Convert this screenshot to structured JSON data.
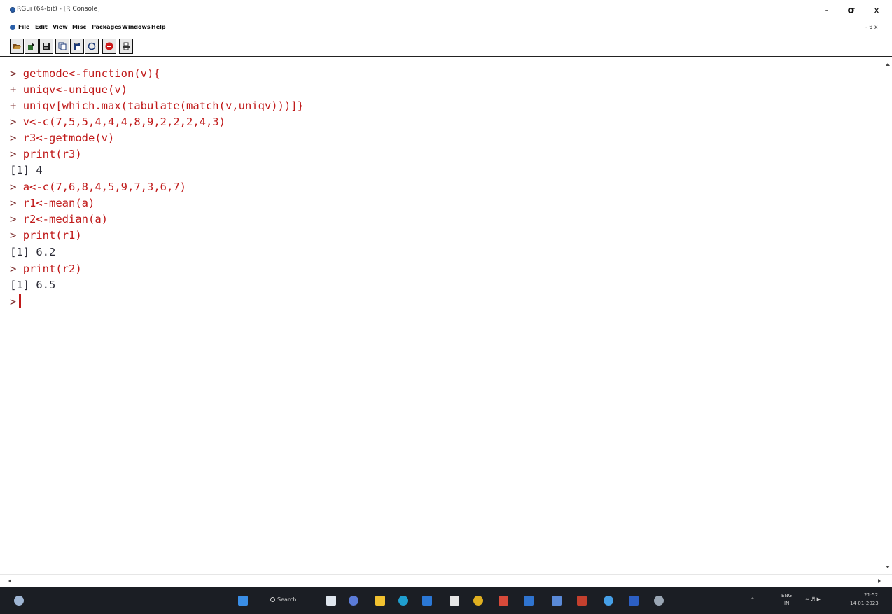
{
  "window": {
    "title": "RGui (64-bit) - [R Console]",
    "controls": {
      "minimize": "-",
      "maximize": "σ",
      "close": "x"
    },
    "mdi_controls": "- θ x"
  },
  "menu": {
    "items": [
      "File",
      "Edit",
      "View",
      "Misc",
      "Packages",
      "Windows",
      "Help"
    ]
  },
  "toolbar": {
    "buttons": [
      {
        "name": "open-script",
        "color": "#7a4a18"
      },
      {
        "name": "load-workspace",
        "color": "#2d6b2d"
      },
      {
        "name": "save-workspace",
        "color": "#1a1a1a"
      },
      {
        "name": "copy",
        "color": "#1c3a78"
      },
      {
        "name": "paste",
        "color": "#1c3a78"
      },
      {
        "name": "copy-and-paste",
        "color": "#1c3a78"
      },
      {
        "name": "stop",
        "color": "#cc1a1a"
      },
      {
        "name": "print",
        "color": "#333333"
      }
    ]
  },
  "console": {
    "lines": [
      {
        "prompt": ">",
        "text": "getmode<-function(v){",
        "kind": "code"
      },
      {
        "prompt": "+",
        "text": "uniqv<-unique(v)",
        "kind": "code"
      },
      {
        "prompt": "+",
        "text": "uniqv[which.max(tabulate(match(v,uniqv)))]}",
        "kind": "code"
      },
      {
        "prompt": ">",
        "text": "v<-c(7,5,5,4,4,4,8,9,2,2,2,4,3)",
        "kind": "code"
      },
      {
        "prompt": ">",
        "text": "r3<-getmode(v)",
        "kind": "code"
      },
      {
        "prompt": ">",
        "text": "print(r3)",
        "kind": "code"
      },
      {
        "prompt": "",
        "text": "[1] 4",
        "kind": "output"
      },
      {
        "prompt": ">",
        "text": "a<-c(7,6,8,4,5,9,7,3,6,7)",
        "kind": "code"
      },
      {
        "prompt": ">",
        "text": "r1<-mean(a)",
        "kind": "code"
      },
      {
        "prompt": ">",
        "text": "r2<-median(a)",
        "kind": "code"
      },
      {
        "prompt": ">",
        "text": "print(r1)",
        "kind": "code"
      },
      {
        "prompt": "",
        "text": "[1] 6.2",
        "kind": "output"
      },
      {
        "prompt": ">",
        "text": "print(r2)",
        "kind": "code"
      },
      {
        "prompt": "",
        "text": "[1] 6.5",
        "kind": "output"
      },
      {
        "prompt": ">",
        "text": "",
        "kind": "input"
      }
    ],
    "colors": {
      "prompt": "#7d2e2e",
      "code": "#c01a1a",
      "output": "#2a2a35"
    }
  },
  "taskbar": {
    "search_label": "Search",
    "tray": {
      "language_top": "ENG",
      "language_bottom": "IN",
      "time": "21:52",
      "date": "14-01-2023"
    },
    "apps": [
      {
        "name": "widgets-icon",
        "color": "#9fb6d4"
      },
      {
        "name": "start-icon",
        "color": "#3a8ee6"
      },
      {
        "name": "task-view-icon",
        "color": "#dfe6ee"
      },
      {
        "name": "chat-icon",
        "color": "#5b7bd8"
      },
      {
        "name": "file-explorer-icon",
        "color": "#f2c230"
      },
      {
        "name": "edge-icon",
        "color": "#1f9fd0"
      },
      {
        "name": "mail-icon",
        "color": "#2b78d6"
      },
      {
        "name": "store-icon",
        "color": "#e6e6e6"
      },
      {
        "name": "chrome-icon",
        "color": "#e0b020"
      },
      {
        "name": "paint-icon",
        "color": "#d84a3a"
      },
      {
        "name": "app-icon-1",
        "color": "#2f74d0"
      },
      {
        "name": "app-icon-2",
        "color": "#5a8ad8"
      },
      {
        "name": "pdf-icon",
        "color": "#c4402e"
      },
      {
        "name": "app-icon-3",
        "color": "#46a0e8"
      },
      {
        "name": "app-icon-4",
        "color": "#2c5fc4"
      },
      {
        "name": "cortana-icon",
        "color": "#9aa6b4"
      }
    ]
  }
}
